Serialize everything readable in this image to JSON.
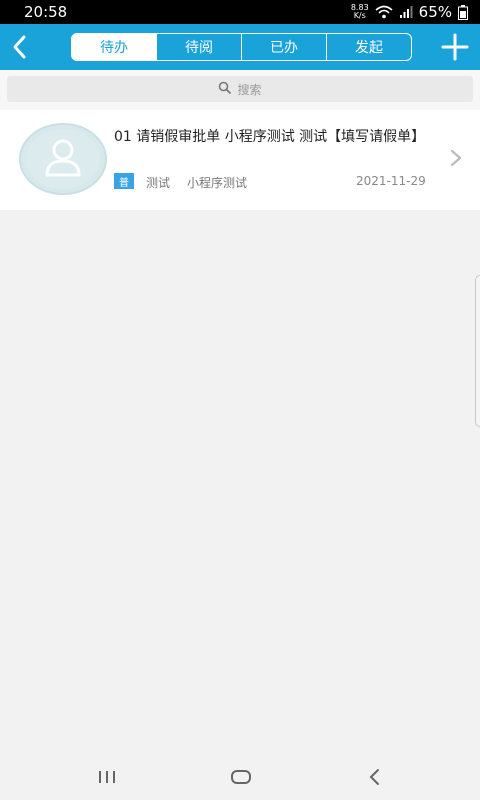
{
  "status_bar": {
    "time": "20:58",
    "net_speed_value": "8.83",
    "net_speed_unit": "K/s",
    "battery": "65%"
  },
  "header": {
    "tabs": [
      {
        "label": "待办",
        "active": true
      },
      {
        "label": "待阅",
        "active": false
      },
      {
        "label": "已办",
        "active": false
      },
      {
        "label": "发起",
        "active": false
      }
    ],
    "accent_color": "#1aa3d9"
  },
  "search": {
    "placeholder": "搜索"
  },
  "list": {
    "items": [
      {
        "title": "01 请销假审批单 小程序测试 测试【填写请假单】",
        "tag": "普",
        "meta1": "测试",
        "meta2": "小程序测试",
        "date": "2021-11-29"
      }
    ]
  },
  "icons": {
    "back": "back-icon",
    "add": "add-icon",
    "search": "search-icon",
    "avatar": "user-avatar-icon",
    "chevron": "chevron-right-icon"
  }
}
